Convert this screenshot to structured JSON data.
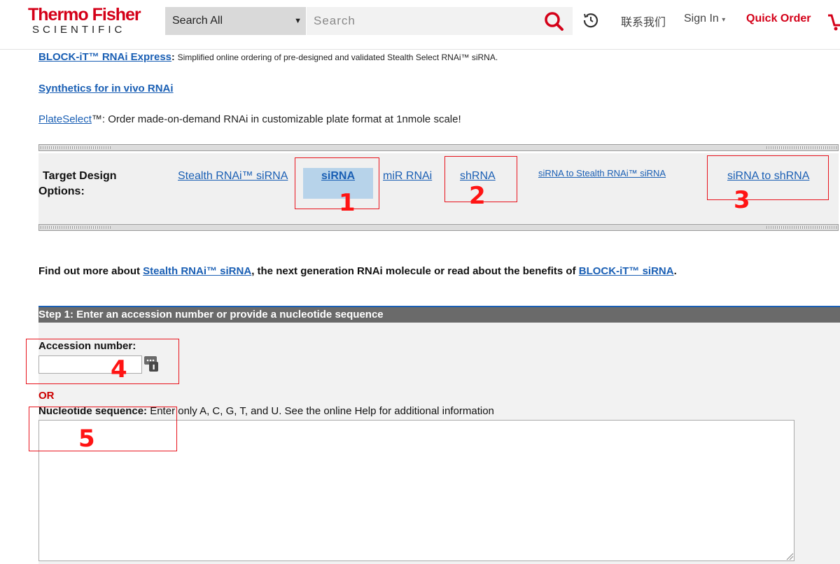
{
  "header": {
    "logo_line1": "Thermo Fisher",
    "logo_line2": "SCIENTIFIC",
    "search_scope": "Search All",
    "search_placeholder": "Search",
    "contact_us": "联系我们",
    "sign_in": "Sign In",
    "quick_order": "Quick Order"
  },
  "links": {
    "block_it_express": "BLOCK-iT™ RNAi Express",
    "block_it_express_desc": "Simplified online ordering of pre-designed and validated Stealth Select RNAi™ siRNA.",
    "synthetics": "Synthetics for in vivo RNAi",
    "plateselect": "PlateSelect",
    "plateselect_desc": "™: Order made-on-demand RNAi in customizable plate format at 1nmole scale!"
  },
  "options": {
    "label_line1": "Target Design",
    "label_line2": "Options:",
    "items": [
      "Stealth RNAi™ siRNA",
      "siRNA",
      "miR RNAi",
      "shRNA",
      "siRNA to Stealth RNAi™ siRNA",
      "siRNA to shRNA"
    ]
  },
  "find_more": {
    "prefix": "Find out more about ",
    "link1": "Stealth RNAi™ siRNA",
    "middle": ", the next generation RNAi molecule or read about the benefits of ",
    "link2": "BLOCK-iT™ siRNA",
    "suffix": "."
  },
  "step1": {
    "title": "Step 1: Enter an accession number or provide a nucleotide sequence",
    "accession_label": "Accession number:",
    "or_label": "OR",
    "sequence_label": "Nucleotide sequence:",
    "sequence_hint": " Enter only A, C, G, T, and U. See the online Help for additional information"
  },
  "annotations": [
    "1",
    "2",
    "3",
    "4",
    "5"
  ],
  "colors": {
    "brand_red": "#d40018",
    "link_blue": "#1a5fb4",
    "annotation_red": "#e8131c",
    "selected_bg": "#b7d3ea"
  }
}
